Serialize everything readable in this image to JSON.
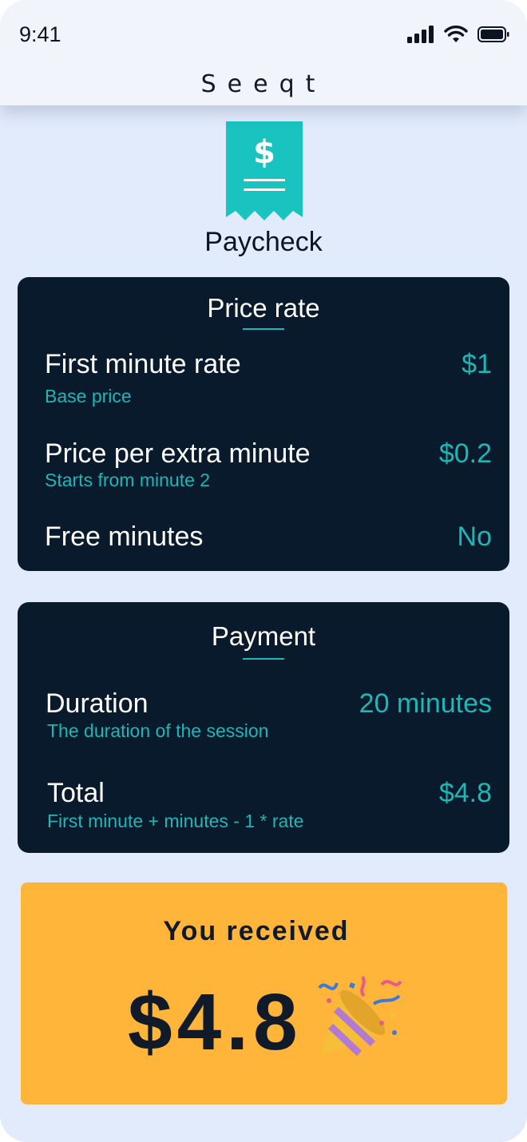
{
  "status_bar": {
    "time": "9:41",
    "icons": [
      "signal-icon",
      "wifi-icon",
      "battery-icon"
    ]
  },
  "header": {
    "logo_text": "Seeqt"
  },
  "receipt": {
    "icon": "receipt-dollar-icon",
    "title": "Paycheck"
  },
  "price_rate": {
    "title": "Price rate",
    "rows": [
      {
        "label": "First minute rate",
        "sub": "Base price",
        "value": "$1"
      },
      {
        "label": "Price per extra minute",
        "sub": "Starts from minute 2",
        "value": "$0.2"
      },
      {
        "label": "Free minutes",
        "sub": "",
        "value": "No"
      }
    ]
  },
  "payment": {
    "title": "Payment",
    "rows": [
      {
        "label": "Duration",
        "sub": "The duration of the session",
        "value": "20 minutes"
      },
      {
        "label": "Total",
        "sub": "First minute + minutes - 1 * rate",
        "value": "$4.8"
      }
    ]
  },
  "received": {
    "label": "You received",
    "amount": "$4.8",
    "icon": "party-popper-icon"
  },
  "colors": {
    "background": "#e1ebfb",
    "card": "#081a2c",
    "accent_teal": "#1fb6b6",
    "received_bg": "#ffb43a"
  }
}
